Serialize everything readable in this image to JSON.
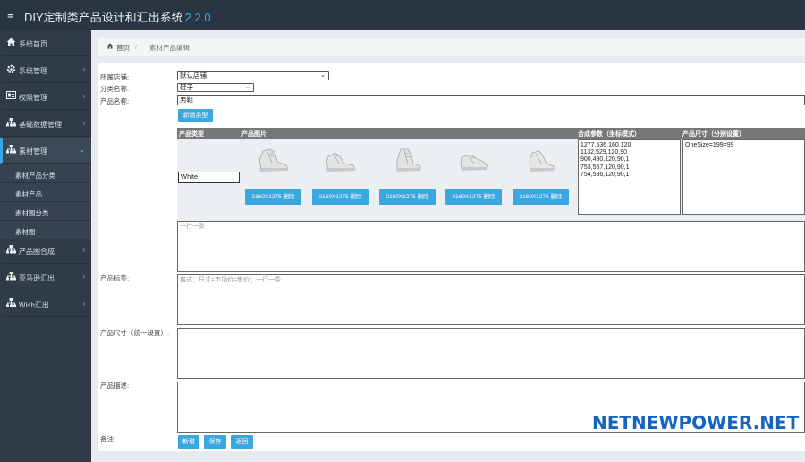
{
  "app": {
    "title": "DIY定制类产品设计和汇出系统",
    "version": "2.2.0"
  },
  "sidebar": {
    "items": [
      {
        "label": "系统首页",
        "icon": "home-icon"
      },
      {
        "label": "系统管理",
        "icon": "gear-icon"
      },
      {
        "label": "权限管理",
        "icon": "id-card-icon"
      },
      {
        "label": "基础数据管理",
        "icon": "sitemap-icon"
      },
      {
        "label": "素材管理",
        "icon": "sitemap-icon"
      },
      {
        "label": "产品图合成",
        "icon": "sitemap-icon"
      },
      {
        "label": "亚马逊汇出",
        "icon": "sitemap-icon"
      },
      {
        "label": "Wish汇出",
        "icon": "sitemap-icon"
      }
    ],
    "subitems": [
      "素材产品分类",
      "素材产品",
      "素材图分类",
      "素材图"
    ]
  },
  "breadcrumb": {
    "home": "首页",
    "current": "素材产品编辑"
  },
  "form": {
    "store_label": "所属店铺:",
    "store_value": "默认店铺",
    "category_label": "分类名称:",
    "category_value": "鞋子",
    "name_label": "产品名称:",
    "name_value": "男鞋",
    "add_type_button": "新增类型",
    "table_headers": {
      "type": "产品类型",
      "images": "产品图片",
      "compose": "合成参数（坐标模式）",
      "size": "产品尺寸（分别设置）"
    },
    "type_value": "White",
    "image_buttons": [
      "2160X1275 删除",
      "2160X1275 删除",
      "2160X1275 删除",
      "2160X1275 删除",
      "2160X1275 删除"
    ],
    "compose_params": "1277,536,160,120\n1132,529,120,90\n900,490,120,90,1\n753,557,120,90,1\n754,536,120,90,1",
    "size_params": "OneSize=199=99",
    "tags_label": "产品标签:",
    "tags_placeholder": "一行一条",
    "size_all_label": "产品尺寸（统一设置）:",
    "size_all_placeholder": "格式：尺寸=市场价=售价；一行一条",
    "desc_label": "产品描述:",
    "remark_label": "备注:",
    "buttons": {
      "add": "新增",
      "save": "保存",
      "back": "返回"
    }
  },
  "watermark": "NETNEWPOWER.NET",
  "colors": {
    "topbar": "#2a3542",
    "sidebar": "#2f3b47",
    "accent": "#3aa7e0",
    "watermark": "#1565c0"
  }
}
